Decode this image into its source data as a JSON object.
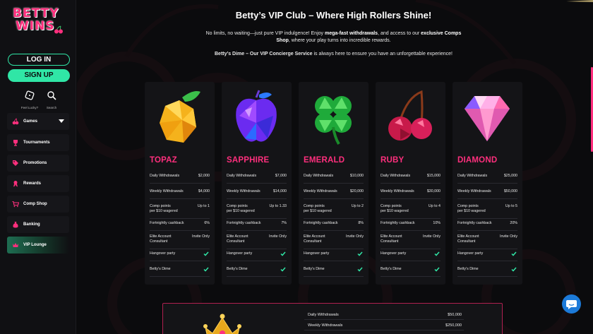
{
  "brand": {
    "line1": "BETTY",
    "line2": "WINS"
  },
  "auth": {
    "login_label": "LOG IN",
    "signup_label": "SIGN UP"
  },
  "quick_actions": [
    {
      "label": "Feel Lucky?",
      "icon": "dice-icon"
    },
    {
      "label": "Search",
      "icon": "search-icon"
    }
  ],
  "nav": [
    {
      "label": "Games",
      "icon": "cherry-icon",
      "has_caret": true
    },
    {
      "label": "Tournaments",
      "icon": "trophy-icon"
    },
    {
      "label": "Promotions",
      "icon": "tag-icon"
    },
    {
      "label": "Rewards",
      "icon": "ribbon-icon"
    },
    {
      "label": "Comp Shop",
      "icon": "cart-icon"
    },
    {
      "label": "Banking",
      "icon": "moneybag-icon"
    },
    {
      "label": "VIP Lounge",
      "icon": "crown-icon",
      "active": true
    }
  ],
  "header": {
    "title": "Betty’s VIP Club – Where High Rollers Shine!",
    "intro_pre": "No limits, no waiting—just pure VIP indulgence! Enjoy ",
    "intro_bold1": "mega-fast withdrawals",
    "intro_mid": ", and access to our ",
    "intro_bold2": "exclusive Comps Shop",
    "intro_post": ", where your play turns into incredible rewards.",
    "intro2_bold": "Betty’s Dime – Our VIP Concierge Service",
    "intro2_rest": " is always here to ensure you have an unforgettable experience!"
  },
  "tiers": [
    {
      "name": "TOPAZ",
      "gem": "lemon-gem-icon",
      "daily": "$2,000",
      "weekly": "$4,000",
      "comp": "Up to 1",
      "cashback": "6%",
      "elite": "Invite Only"
    },
    {
      "name": "SAPPHIRE",
      "gem": "apple-gem-icon",
      "daily": "$7,000",
      "weekly": "$14,000",
      "comp": "Up to 1.33",
      "cashback": "7%",
      "elite": "Invite Only"
    },
    {
      "name": "EMERALD",
      "gem": "clover-gem-icon",
      "daily": "$10,000",
      "weekly": "$20,000",
      "comp": "Up to 2",
      "cashback": "8%",
      "elite": "Invite Only"
    },
    {
      "name": "RUBY",
      "gem": "cherry-gem-icon",
      "daily": "$15,000",
      "weekly": "$30,000",
      "comp": "Up to 4",
      "cashback": "10%",
      "elite": "Invite Only"
    },
    {
      "name": "DIAMOND",
      "gem": "diamond-gem-icon",
      "daily": "$25,000",
      "weekly": "$50,000",
      "comp": "Up to 5",
      "cashback": "20%",
      "elite": "Invite Only"
    }
  ],
  "row_labels": {
    "daily": "Daily Withdrawals",
    "weekly": "Weekly Withdrawals",
    "comp_line1": "Comp points",
    "comp_line2": "per $10 wagered",
    "cashback": "Fortnightly cashback",
    "elite_line1": "Elite Account",
    "elite_line2": "Consultant",
    "hangover": "Hangover party",
    "dime": "Betty's Dime"
  },
  "top_tier": {
    "daily_label": "Daily Withdrawals",
    "daily": "$50,000",
    "weekly_label": "Weekly Withdrawals",
    "weekly": "$250,000"
  },
  "colors": {
    "accent_pink": "#ff2f7d",
    "accent_green": "#30e6a6",
    "chat_blue": "#1c7ad8"
  },
  "chat": {
    "icon": "chat-bubble-icon"
  }
}
